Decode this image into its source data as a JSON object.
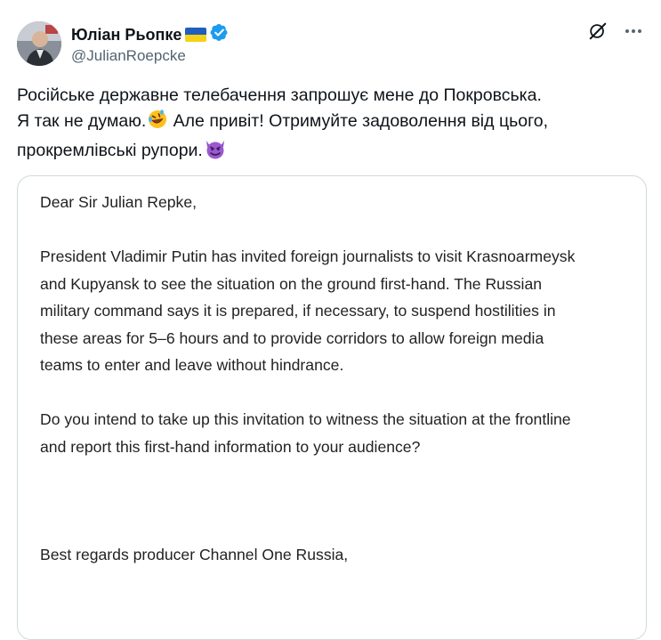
{
  "author": {
    "display_name": "Юліан Рьопке",
    "handle": "@JulianRoepcke",
    "flag": "ukraine-flag-emoji",
    "verified": true,
    "verified_color": "#1d9bf0"
  },
  "tweet": {
    "lines": [
      "Російське державне телебачення запрошує мене до Покровська.",
      "Я так не думаю.",
      " Але привіт! Отримуйте задоволення від цього,",
      "прокремлівські рупори."
    ],
    "emoji_1": "rolling-on-floor-laughing-emoji",
    "emoji_2": "smiling-face-with-horns-emoji"
  },
  "letter": {
    "greeting": "Dear Sir Julian Repke,",
    "paragraph1": [
      "President Vladimir Putin has invited foreign journalists to visit Krasnoarmeysk",
      "and Kupyansk to see the situation on the ground first-hand. The Russian",
      "military command says it is prepared, if necessary, to suspend hostilities in",
      "these areas for 5–6 hours and to provide corridors to allow foreign media",
      "teams to enter and leave without hindrance."
    ],
    "paragraph2": [
      "Do you intend to take up this invitation to witness the situation at the frontline",
      "and report this first-hand information to your audience?"
    ],
    "signoff": "Best regards producer Channel One Russia,"
  },
  "icons": {
    "grok": "grok-icon",
    "more": "more-icon"
  }
}
